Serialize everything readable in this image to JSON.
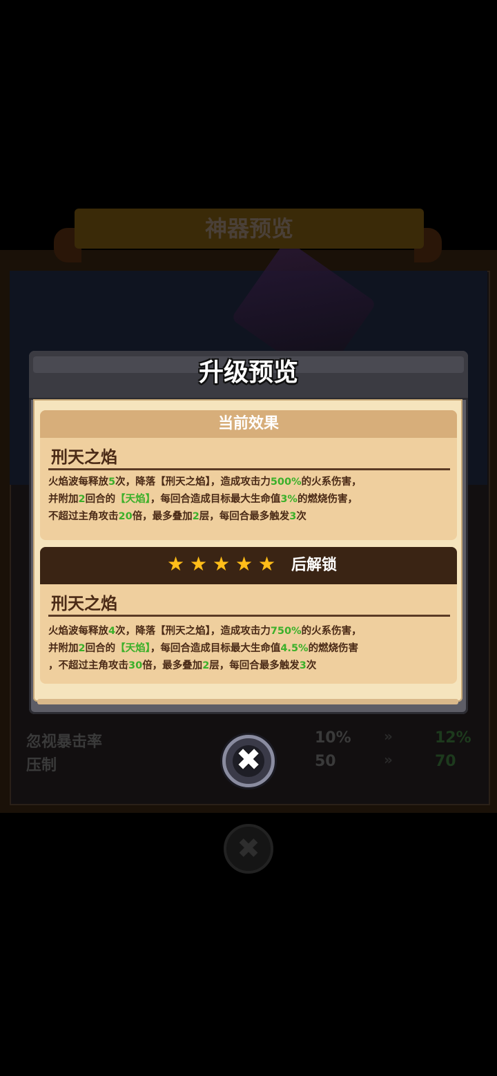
{
  "background": {
    "banner_title": "神器预览",
    "stats": [
      {
        "label": "忽视暴击率",
        "from": "10%",
        "to": "12%"
      },
      {
        "label": "压制",
        "from": "50",
        "to": "70"
      }
    ],
    "close_glyph": "✖",
    "arrow_glyph": "»"
  },
  "modal": {
    "title": "升级预览",
    "current": {
      "header": "当前效果",
      "skill_name": "刑天之焰",
      "line1": {
        "a": "火焰波每释放",
        "b": "5",
        "c": "次，降落【刑天之焰】，造成攻击力",
        "d": "500%",
        "e": "的火系伤害，"
      },
      "line2": {
        "a": "并附加",
        "b": "2",
        "c": "回合的",
        "d": "【天焰】",
        "e": "，每回合造成目标最大生命值",
        "f": "3%",
        "g": "的燃烧伤害，"
      },
      "line3": {
        "a": "不超过主角攻击",
        "b": "20",
        "c": "倍，最多叠加",
        "d": "2",
        "e": "层，每回合最多触发",
        "f": "3",
        "g": "次"
      }
    },
    "next": {
      "stars": 5,
      "star_glyph": "★",
      "unlock_label": "后解锁",
      "skill_name": "刑天之焰",
      "line1": {
        "a": "火焰波每释放",
        "b": "4",
        "c": "次，降落【刑天之焰】，造成攻击力",
        "d": "750%",
        "e": "的火系伤害，"
      },
      "line2": {
        "a": "并附加",
        "b": "2",
        "c": "回合的",
        "d": "【天焰】",
        "e": "，每回合造成目标最大生命值",
        "f": "4.5%",
        "g": "的燃烧伤害"
      },
      "line3": {
        "a": "，不超过主角攻击",
        "b": "30",
        "c": "倍，最多叠加",
        "d": "2",
        "e": "层，每回合最多触发",
        "f": "3",
        "g": "次"
      }
    },
    "close_glyph": "✖"
  }
}
